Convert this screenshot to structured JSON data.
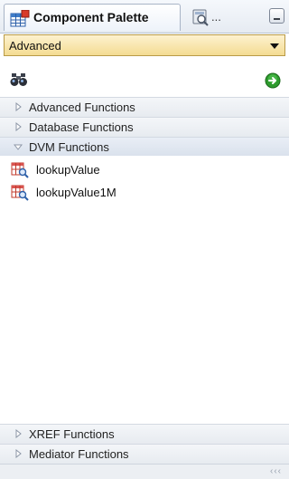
{
  "tabs": {
    "active": {
      "title": "Component Palette",
      "icon": "component-palette-icon"
    },
    "inactive": {
      "title": "...",
      "icon": "properties-icon"
    }
  },
  "category_select": {
    "value": "Advanced"
  },
  "search": {
    "placeholder": "",
    "value": ""
  },
  "sections": {
    "advanced": {
      "label": "Advanced Functions",
      "expanded": false
    },
    "database": {
      "label": "Database Functions",
      "expanded": false
    },
    "dvm": {
      "label": "DVM Functions",
      "expanded": true
    },
    "xref": {
      "label": "XREF Functions",
      "expanded": false
    },
    "mediator": {
      "label": "Mediator Functions",
      "expanded": false
    }
  },
  "dvm_items": [
    {
      "label": "lookupValue",
      "icon": "function-table-icon"
    },
    {
      "label": "lookupValue1M",
      "icon": "function-table-icon"
    }
  ],
  "status": {
    "grip": "‹‹‹"
  },
  "colors": {
    "dropdown_bg": "#f4dc92",
    "go_button": "#2e9b2e",
    "header_gradient": "#e7ebf0"
  }
}
